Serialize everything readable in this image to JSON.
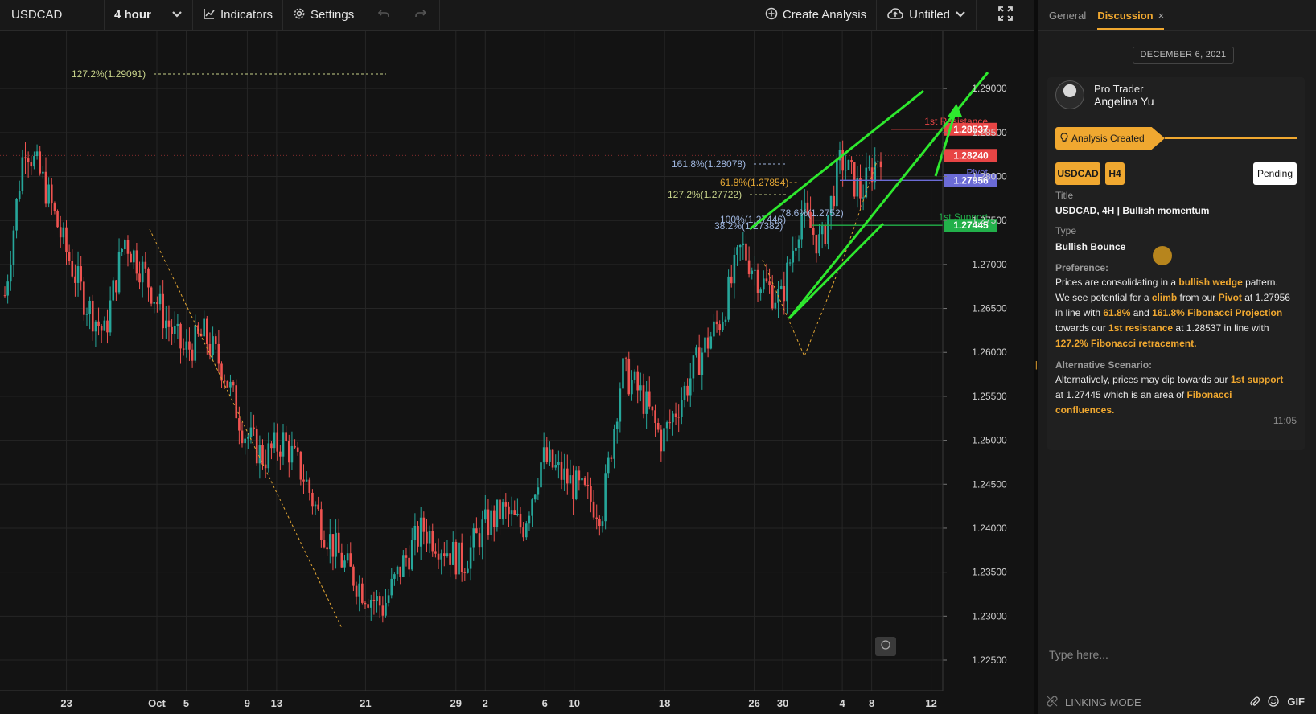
{
  "toolbar": {
    "symbol": "USDCAD",
    "interval": "4 hour",
    "indicators_label": "Indicators",
    "settings_label": "Settings",
    "create_analysis_label": "Create Analysis",
    "layout_name": "Untitled"
  },
  "chart_data": {
    "type": "candlestick",
    "symbol": "USDCAD",
    "timeframe": "4 hour",
    "ylim": [
      1.225,
      1.2955
    ],
    "price_ticks": [
      "1.29000",
      "1.28500",
      "1.28000",
      "1.27500",
      "1.27000",
      "1.26500",
      "1.26000",
      "1.25500",
      "1.25000",
      "1.24500",
      "1.24000",
      "1.23500",
      "1.23000",
      "1.22500"
    ],
    "date_ticks": [
      "23",
      "Oct",
      "5",
      "9",
      "13",
      "21",
      "29",
      "2",
      "6",
      "10",
      "18",
      "26",
      "30",
      "4",
      "8",
      "12"
    ],
    "approx_close_path": [
      1.2665,
      1.284,
      1.279,
      1.272,
      1.266,
      1.262,
      1.273,
      1.269,
      1.264,
      1.26,
      1.262,
      1.258,
      1.251,
      1.248,
      1.25,
      1.246,
      1.24,
      1.236,
      1.233,
      1.231,
      1.236,
      1.24,
      1.238,
      1.236,
      1.24,
      1.242,
      1.24,
      1.248,
      1.246,
      1.244,
      1.242,
      1.258,
      1.255,
      1.25,
      1.255,
      1.26,
      1.264,
      1.272,
      1.268,
      1.266,
      1.276,
      1.272,
      1.282,
      1.278,
      1.283
    ],
    "horizontal_levels": [
      {
        "name": "1st Resistance",
        "value": 1.28537,
        "value_label": "1.28537",
        "color": "#e84545"
      },
      {
        "name": "Pivot",
        "value": 1.27956,
        "value_label": "1.27956",
        "color": "#6b6bd6"
      },
      {
        "name": "1st Support",
        "value": 1.27445,
        "value_label": "1.27445",
        "color": "#22b04a"
      },
      {
        "name": "",
        "value": 1.2824,
        "value_label": "1.28240",
        "color": "#e84545"
      }
    ],
    "fib_labels": [
      {
        "text": "127.2%(1.29091)",
        "color": "#c7d28a"
      },
      {
        "text": "161.8%(1.28078)",
        "color": "#9fb6df"
      },
      {
        "text": "61.8%(1.27854)",
        "color": "#e3a634"
      },
      {
        "text": "127.2%(1.27722)",
        "color": "#c7d28a"
      },
      {
        "text": "100%(1.27446)",
        "color": "#9fb6df"
      },
      {
        "text": "78.6%(1.2752)",
        "color": "#9fb6df"
      },
      {
        "text": "38.2%(1.27382)",
        "color": "#9fb6df"
      }
    ],
    "grid": true
  },
  "panel": {
    "tab_general": "General",
    "tab_discussion": "Discussion",
    "tab_close": "×",
    "date_separator": "DECEMBER 6, 2021",
    "author_role": "Pro Trader",
    "author_name": "Angelina Yu",
    "banner_label": "Analysis Created",
    "chip_symbol": "USDCAD",
    "chip_tf": "H4",
    "status": "Pending",
    "title_label": "Title",
    "title_value": "USDCAD, 4H | Bullish momentum",
    "type_label": "Type",
    "type_value": "Bullish Bounce",
    "preference_label": "Preference:",
    "preference": {
      "t1": "Prices are consolidating in a ",
      "h1": "bullish wedge",
      "t2": " pattern. We see potential for a ",
      "h2": "climb",
      "t3": " from our ",
      "h3": "Pivot",
      "t4": " at 1.27956 in line with ",
      "h4": "61.8%",
      "t5": " and ",
      "h5": "161.8% Fibonacci Projection",
      "t6": " towards our ",
      "h6": "1st resistance",
      "t7": " at 1.28537 in line with ",
      "h7": "127.2% Fibonacci retracement."
    },
    "alternative_label": "Alternative Scenario:",
    "alternative": {
      "t1": "Alternatively, prices may dip towards our ",
      "h1": "1st support",
      "t2": " at 1.27445 which is an area of ",
      "h2": "Fibonacci confluences."
    },
    "time": "11:05",
    "input_placeholder": "Type here...",
    "linking_mode": "LINKING MODE",
    "gif": "GIF"
  }
}
